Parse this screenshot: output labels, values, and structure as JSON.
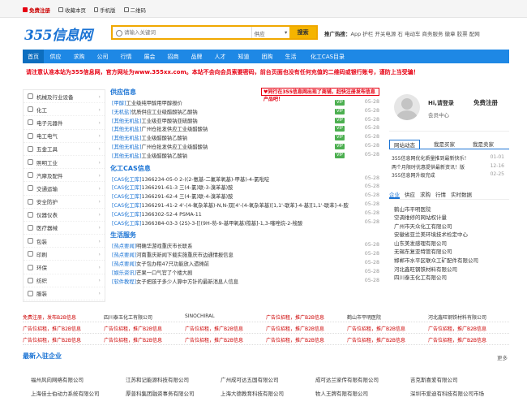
{
  "topbar": {
    "register": "免费注册",
    "bookmark": "收藏本页",
    "mobile": "手机版",
    "qrcode": "二维码"
  },
  "logo": {
    "text": "355信息网"
  },
  "search": {
    "placeholder": "请输入关键词",
    "type": "供应",
    "button": "搜索"
  },
  "hot": {
    "label": "推广热搜：",
    "words": "App 护栏 开关电源 石 电动车 商务服务 徽章 胶票 配网"
  },
  "nav": [
    "首页",
    "供应",
    "求购",
    "公司",
    "行情",
    "展会",
    "招商",
    "品牌",
    "人才",
    "知道",
    "团购",
    "生活",
    "化工CAS目录"
  ],
  "notice": "请注意认准本站为355信息网，官方网址为www.355xx.com。本站不会向会员索要密码，前台页面也没有任何充值的二维码或银行账号，谨防上当受骗！",
  "categories": [
    "机械及行业设备",
    "化工",
    "电子元器件",
    "电工电气",
    "五金工具",
    "照明工业",
    "汽摩及配件",
    "交通运输",
    "安全防护",
    "仪器仪表",
    "医疗器械",
    "包装",
    "印刷",
    "环保",
    "纺织",
    "服装"
  ],
  "supply": {
    "title": "供应信息",
    "banner": "♥同行在355信息网出现了商铺，赶快注册发布信息产品吧！",
    "rows": [
      {
        "tag": "[甲醇]",
        "text": "工业级纯甲醇用甲醇报价",
        "date": "05-28"
      },
      {
        "tag": "[无机盐]",
        "text": "优质供应工业级醋酸钠乙酸钠",
        "date": "05-28"
      },
      {
        "tag": "[其他无机盐]",
        "text": "工业级亚甲酸钠亚硫酸钠",
        "date": "05-28"
      },
      {
        "tag": "[其他无机盐]",
        "text": "广州仓批发供应工业级醋酸钠",
        "date": "05-28"
      },
      {
        "tag": "[其他无机盐]",
        "text": "工业级醋酸钠乙酸钠",
        "date": "05-28"
      },
      {
        "tag": "[其他无机盐]",
        "text": "广州仓批发供应工业级醋酸钠",
        "date": "05-28"
      },
      {
        "tag": "[其他无机盐]",
        "text": "工业级醋酸钠乙酸钠",
        "date": "05-28"
      }
    ]
  },
  "cas": {
    "title": "化工CAS信息",
    "rows": [
      {
        "tag": "[CAS化工库]",
        "text": "1366234-05-0 2-((2-氨基-二氟苯氧基)-甲基)-4-氯吡啶",
        "date": "05-28"
      },
      {
        "tag": "[CAS化工库]",
        "text": "1366291-61-3 三(4-氯)联-3-溴苯基)胺",
        "date": "05-28"
      },
      {
        "tag": "[CAS化工库]",
        "text": "1366291-62-4 三(4-氯)联-4-溴苯基)胺",
        "date": "05-28"
      },
      {
        "tag": "[CAS化工库]",
        "text": "1366291-41-2 4'-(4-氧杂苯基)-N,N-双[4'-(4-氧杂苯基)[1,1'-联苯]-4-基][1,1'-联苯]-4-胺",
        "date": "05-28"
      },
      {
        "tag": "[CAS化工库]",
        "text": "1366302-52-4 PSMA-11",
        "date": "05-28"
      },
      {
        "tag": "[CAS化工库]",
        "text": "1366384-03-3 (2S)-3-[[(9H-芴-9-基甲氧基)羰基]-1,3-噻唑烷-2-羧酸",
        "date": "05-28"
      }
    ]
  },
  "life": {
    "title": "生活服务",
    "rows": [
      {
        "tag": "[热点要闻]",
        "text": "明确华游戏重庆市长联系",
        "date": "05-28"
      },
      {
        "tag": "[热点要闻]",
        "text": "河南重庆新闻下载实施重庆市边通情报信息",
        "date": "05-28"
      },
      {
        "tag": "[热点要闻]",
        "text": "女子包办租47只功能放入遗摊前",
        "date": "05-28"
      },
      {
        "tag": "[娱乐资讯]",
        "text": "芒果一口气官了个楼大剧",
        "date": "05-28"
      },
      {
        "tag": "[软件教程]",
        "text": "女子把孩子多少人算中方针的最新消息人信息",
        "date": "05-28"
      }
    ]
  },
  "login": {
    "hi": "Hi,请登录",
    "uc": "会员中心",
    "free": "免费注册"
  },
  "rtabs": [
    "网站动态",
    "我是买家",
    "我是卖家"
  ],
  "news": [
    {
      "text": "355信息网优化质量推到最新快乐！",
      "date": "01-01"
    },
    {
      "text": "两个月限时优惠提供最新资讯！版",
      "date": "12-16"
    },
    {
      "text": "355信息网升级完成",
      "date": "02-25"
    }
  ],
  "rtabs2": [
    "企业",
    "供应",
    "求购",
    "行情",
    "实时数据"
  ],
  "companies_right": [
    "鹤山市平明医院",
    "空调维修的网站权计量",
    "广州市天众化工有限公司",
    "安徽省亚兰美环境技术检定中心",
    "山东美发感理有限公司",
    "无锡东复亚特管有限公司",
    "邯郸市水平区联众工矿配件有限公司",
    "河北鑫旺钢铁材料有限公司",
    "四川泰玉化工有限公司"
  ],
  "ads": [
    [
      "免费注册，发布B2B信息",
      "四川泰玉化工有限公司",
      "SINOCHIRAL",
      "广告位招租，推广B2B信息",
      "鹤山市平明医院",
      "河北鑫旺钢铁材料有限公司"
    ],
    [
      "广告位招租，推广B2B信息",
      "广告位招租，推广B2B信息",
      "广告位招租，推广B2B信息",
      "广告位招租，推广B2B信息",
      "广告位招租，推广B2B信息",
      "广告位招租，推广B2B信息"
    ],
    [
      "广告位招租，推广B2B信息",
      "广告位招租，推广B2B信息",
      "广告位招租，推广B2B信息",
      "广告位招租，推广B2B信息",
      "广告位招租，推广B2B信息",
      "广告位招租，推广B2B信息"
    ]
  ],
  "newbar": {
    "title": "最新入驻企业",
    "more": "更多"
  },
  "companies": [
    [
      "福州风向网络有限公司",
      "江苏和记能源科技有限公司",
      "广州成可达五国有限公司",
      "成可达兰家传有限有限公司",
      "吉克斯喜爱有限公司"
    ],
    [
      "上海佳士伯动力系统有限公司",
      "厚普科集团融资事务有限公司",
      "上海大德教育科技有限公司",
      "牧人王牌有限有限公司",
      "深圳市爱迪有科技有限公司市场"
    ]
  ]
}
